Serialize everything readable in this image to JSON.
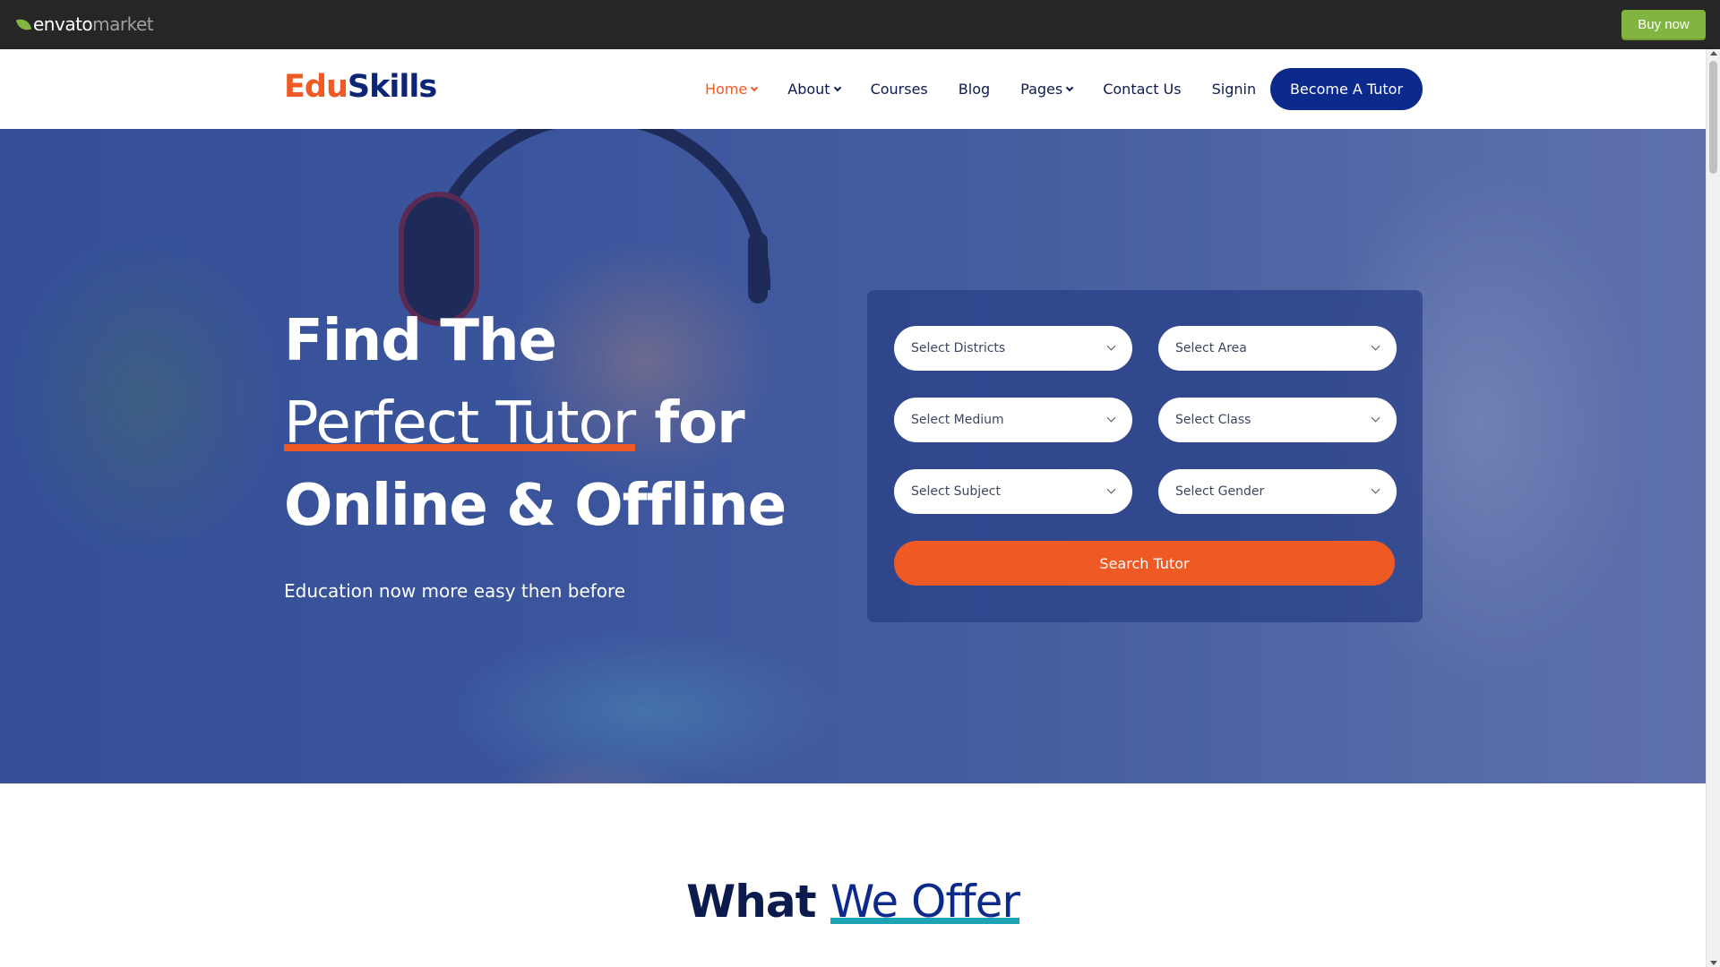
{
  "envato": {
    "logo_envato": "envato",
    "logo_market": "market",
    "buy_now": "Buy now",
    "accent_color": "#82b440"
  },
  "header": {
    "brand_edu": "Edu",
    "brand_skills": "Skills",
    "nav": [
      {
        "label": "Home",
        "dropdown": true,
        "active": true
      },
      {
        "label": "About",
        "dropdown": true,
        "active": false
      },
      {
        "label": "Courses",
        "dropdown": false,
        "active": false
      },
      {
        "label": "Blog",
        "dropdown": false,
        "active": false
      },
      {
        "label": "Pages",
        "dropdown": true,
        "active": false
      },
      {
        "label": "Contact Us",
        "dropdown": false,
        "active": false
      },
      {
        "label": "Signin",
        "dropdown": false,
        "active": false
      }
    ],
    "cta": "Become A Tutor"
  },
  "hero": {
    "title_line1": "Find The",
    "title_highlight": "Perfect Tutor",
    "title_line2_rest": " for",
    "title_line3": "Online & Offline",
    "subtitle": "Education now more easy then before"
  },
  "search": {
    "selects": [
      {
        "label": "Select Districts"
      },
      {
        "label": "Select Area"
      },
      {
        "label": "Select Medium"
      },
      {
        "label": "Select Class"
      },
      {
        "label": "Select Subject"
      },
      {
        "label": "Select Gender"
      }
    ],
    "button": "Search Tutor"
  },
  "offer": {
    "title_plain": "What ",
    "title_highlight": "We Offer"
  },
  "colors": {
    "brand_orange": "#ef5a24",
    "brand_navy": "#0c2a8c",
    "accent_teal": "#1aa4b4"
  }
}
